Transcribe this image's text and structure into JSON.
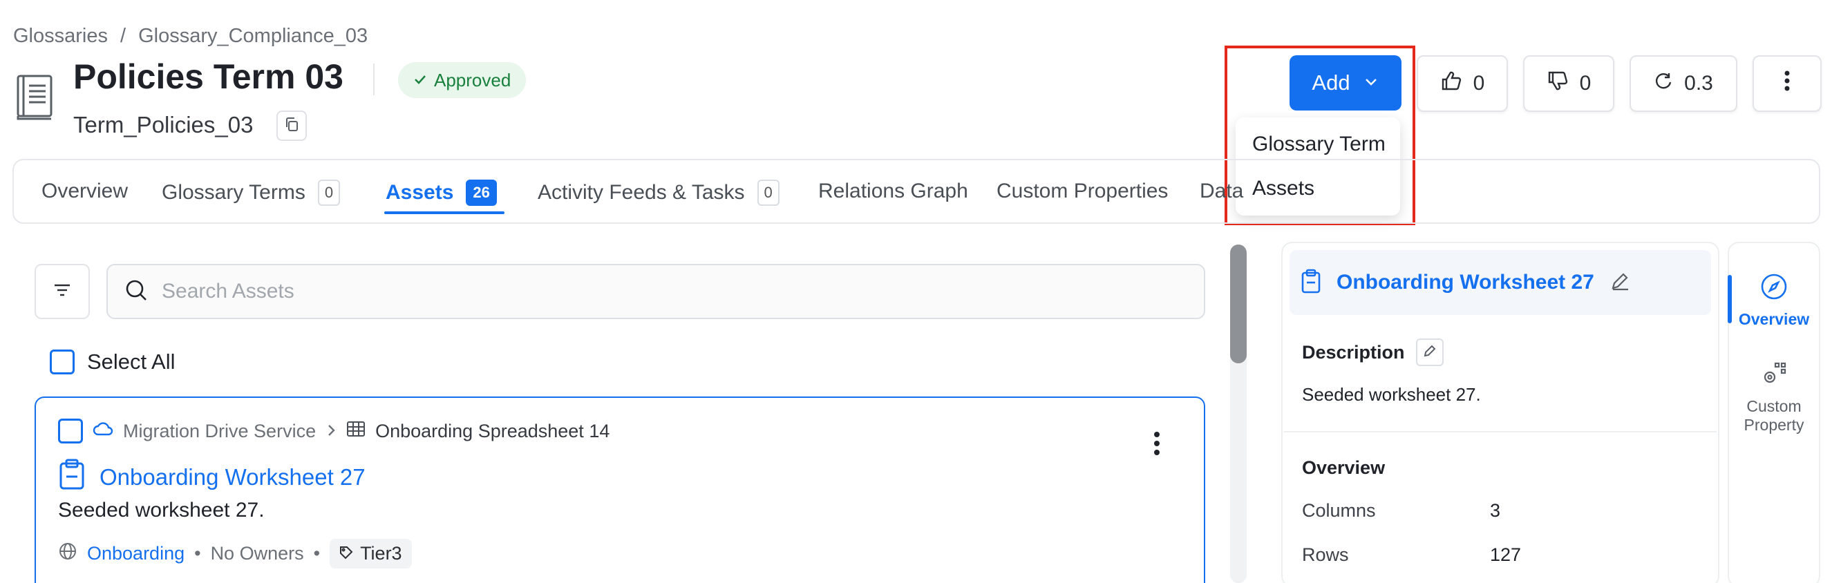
{
  "breadcrumb": {
    "items": [
      "Glossaries",
      "Glossary_Compliance_03"
    ],
    "separator": "/"
  },
  "header": {
    "title": "Policies Term 03",
    "status": "Approved",
    "fqn": "Term_Policies_03"
  },
  "actions": {
    "add_label": "Add",
    "likes": "0",
    "dislikes": "0",
    "version": "0.3"
  },
  "add_menu": {
    "items": [
      "Glossary Term",
      "Assets"
    ]
  },
  "tabs": [
    {
      "label": "Overview"
    },
    {
      "label": "Glossary Terms",
      "count": "0"
    },
    {
      "label": "Assets",
      "count": "26",
      "active": true
    },
    {
      "label": "Activity Feeds & Tasks",
      "count": "0"
    },
    {
      "label": "Relations Graph"
    },
    {
      "label": "Custom Properties"
    },
    {
      "label": "Data"
    }
  ],
  "search": {
    "placeholder": "Search Assets"
  },
  "select_all_label": "Select All",
  "asset_card": {
    "service": "Migration Drive Service",
    "parent": "Onboarding Spreadsheet 14",
    "title": "Onboarding Worksheet 27",
    "description": "Seeded worksheet 27.",
    "domain": "Onboarding",
    "owners": "No Owners",
    "tier": "Tier3",
    "bullet": "•"
  },
  "detail_panel": {
    "title": "Onboarding Worksheet 27",
    "description_label": "Description",
    "description": "Seeded worksheet 27.",
    "overview_label": "Overview",
    "properties": [
      {
        "key": "Columns",
        "value": "3"
      },
      {
        "key": "Rows",
        "value": "127"
      }
    ]
  },
  "side_tabs": {
    "overview": "Overview",
    "custom_property_line1": "Custom",
    "custom_property_line2": "Property"
  },
  "colors": {
    "accent": "#1570ef",
    "approved_bg": "#e8f6ec",
    "approved_text": "#19803d",
    "highlight": "#e5281c"
  }
}
